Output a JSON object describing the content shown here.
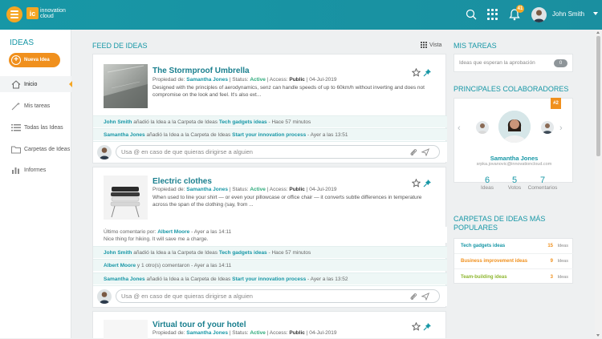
{
  "app": {
    "logo_mark": "ic",
    "logo_line1": "innovation",
    "logo_line2": "cloud"
  },
  "topbar": {
    "user_name": "John Smith",
    "notif_count": "41"
  },
  "sidebar": {
    "title": "IDEAS",
    "new_idea": "Nueva Idea",
    "items": [
      {
        "label": "Inicio",
        "icon": "home-icon"
      },
      {
        "label": "Mis tareas",
        "icon": "tasks-wand-icon"
      },
      {
        "label": "Todas las Ideas",
        "icon": "list-icon"
      },
      {
        "label": "Carpetas de Ideas",
        "icon": "folder-icon"
      },
      {
        "label": "Informes",
        "icon": "bar-chart-icon"
      }
    ]
  },
  "feed": {
    "title": "FEED DE IDEAS",
    "view_label": "Vista",
    "comment_placeholder": "Usa @ en caso de que quieras dirigirse a alguien",
    "meta": {
      "owner_prefix": "Propiedad de:",
      "status_prefix": "| Status:",
      "access_prefix": "| Access:"
    },
    "ideas": [
      {
        "title": "The Stormproof Umbrella",
        "owner": "Samantha Jones",
        "status": "Active",
        "access": "Public",
        "date": "| 04-Jul-2019",
        "description": "Designed with the principles of aerodynamics, senz can handle speeds of up to 60km/h without inverting and does not compromise on the look and feel. It's also ext...",
        "activity": [
          {
            "user": "John Smith",
            "text": "añadió la Idea a la Carpeta de Ideas",
            "folder": "Tech gadgets ideas",
            "time": "- Hace 57 minutos"
          },
          {
            "user": "Samantha Jones",
            "text": "añadió la Idea a la Carpeta de Ideas",
            "folder": "Start your innovation process",
            "time": "- Ayer a las 13:51"
          }
        ]
      },
      {
        "title": "Electric clothes",
        "owner": "Samantha Jones",
        "status": "Active",
        "access": "Public",
        "date": "| 04-Jul-2019",
        "description": "When used to line your shirt — or even your pillowcase or office chair — it converts subtle differences in temperature across the span of the clothing (say, from ...",
        "last_comment": {
          "prefix": "Último comentario por:",
          "user": "Albert Moore",
          "time": "- Ayer a las 14:11",
          "text": "Nice thing for hiking. It will save me a charge."
        },
        "activity": [
          {
            "user": "John Smith",
            "text": "añadió la Idea a la Carpeta de Ideas",
            "folder": "Tech gadgets ideas",
            "time": "- Hace 57 minutos"
          },
          {
            "user": "Albert Moore",
            "text": "y 1 otro(s) comentaron",
            "folder": "",
            "time": "- Ayer a las 14:11"
          },
          {
            "user": "Samantha Jones",
            "text": "añadió la Idea a la Carpeta de Ideas",
            "folder": "Start your innovation process",
            "time": "- Ayer a las 13:52"
          }
        ]
      },
      {
        "title": "Virtual tour of your hotel",
        "owner": "Samantha Jones",
        "status": "Active",
        "access": "Public",
        "date": "| 04-Jul-2019"
      }
    ]
  },
  "right": {
    "tasks_title": "MIS TAREAS",
    "tasks_label": "Ideas que esperan la aprobación",
    "tasks_count": "0",
    "collab_title": "PRINCIPALES COLABORADORES",
    "collab": {
      "rank": "#2",
      "name": "Samantha Jones",
      "email": "srpka.jovanovic@innovationcloud.com",
      "stats": [
        {
          "n": "6",
          "l": "Ideas"
        },
        {
          "n": "5",
          "l": "Votos"
        },
        {
          "n": "7",
          "l": "Comentarios"
        }
      ]
    },
    "folders_title_1": "CARPETAS DE IDEAS MÁS",
    "folders_title_2": "POPULARES",
    "folders": [
      {
        "name": "Tech gadgets ideas",
        "count": "15",
        "unit": "Ideas",
        "color": "#1797a6"
      },
      {
        "name": "Business improvement ideas",
        "count": "9",
        "unit": "Ideas",
        "color": "#f0901d"
      },
      {
        "name": "Team-building ideas",
        "count": "3",
        "unit": "Ideas",
        "color": "#8db62e"
      }
    ]
  },
  "colors": {
    "accent": "#1797a6",
    "orange": "#f0901d",
    "green": "#2eaa7b"
  }
}
